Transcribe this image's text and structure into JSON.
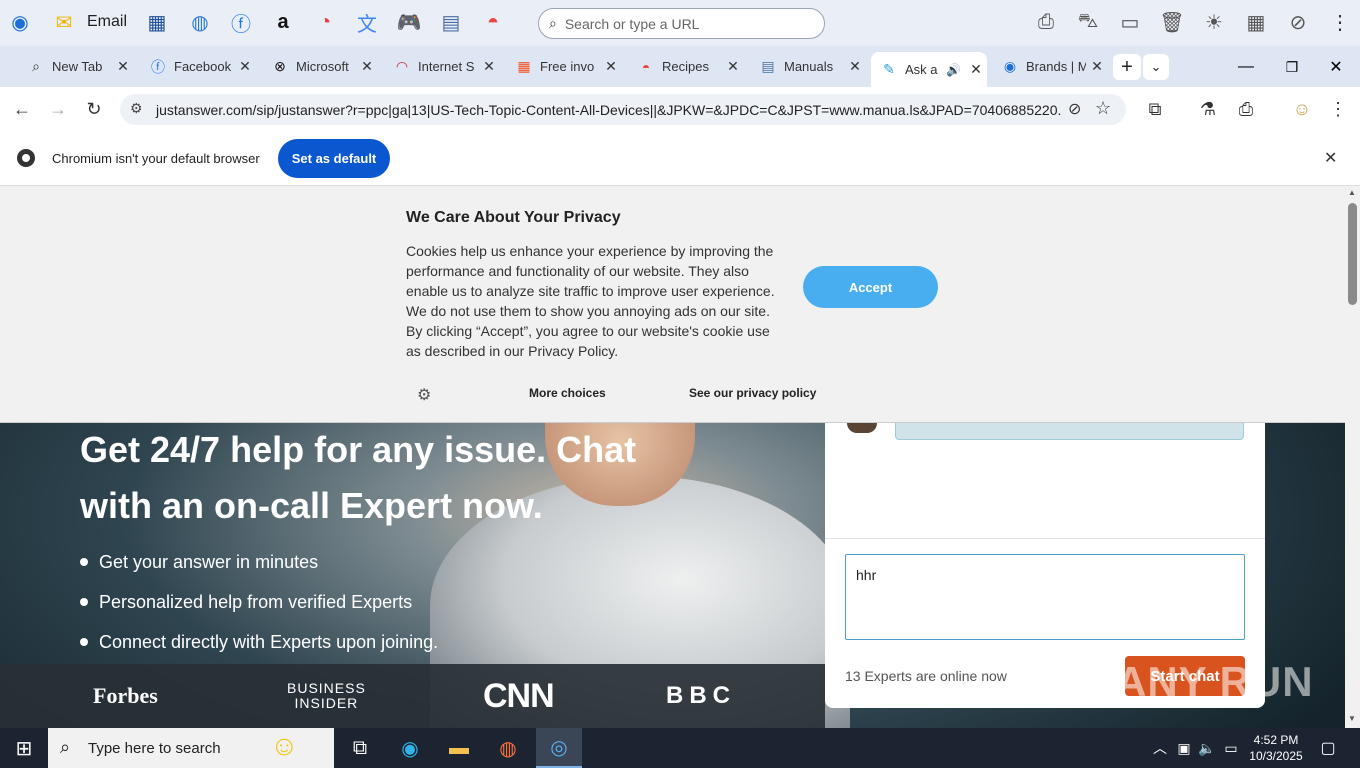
{
  "bookmarks": {
    "email_label": "Email",
    "search_placeholder": "Search or type a URL"
  },
  "tabs": [
    {
      "title": "New Tab",
      "icon": "search-icon"
    },
    {
      "title": "Facebook",
      "icon": "facebook-icon"
    },
    {
      "title": "Microsoft",
      "icon": "xbox-icon"
    },
    {
      "title": "Internet S",
      "icon": "speedometer-icon"
    },
    {
      "title": "Free invo",
      "icon": "windows-icon"
    },
    {
      "title": "Recipes",
      "icon": "watermelon-icon"
    },
    {
      "title": "Manuals",
      "icon": "manual-icon"
    },
    {
      "title": "Ask a",
      "icon": "justanswer-icon"
    },
    {
      "title": "Brands | M",
      "icon": "brands-icon"
    }
  ],
  "address_bar": {
    "url": "justanswer.com/sip/justanswer?r=ppc|ga|13|US-Tech-Topic-Content-All-Devices||&JPKW=&JPDC=C&JPST=www.manua.ls&JPAD=70406885220..."
  },
  "infobar": {
    "message": "Chromium isn't your default browser",
    "button": "Set as default"
  },
  "privacy": {
    "title": "We Care About Your Privacy",
    "body": "Cookies help us enhance your experience by improving the performance and functionality of our website. They also enable us to analyze site traffic to improve user experience. We do not use them to show you annoying ads on our site. By clicking “Accept”, you agree to our website's cookie use as described in our Privacy Policy.",
    "accept": "Accept",
    "more_choices": "More choices",
    "policy": "See our privacy policy"
  },
  "hero": {
    "line1": "Get 24/7 help for any issue. Chat",
    "line2": "with an on-call Expert now.",
    "bullets": [
      "Get your answer in minutes",
      "Personalized help from verified Experts",
      "Connect directly with Experts upon joining."
    ],
    "logos": [
      "Forbes",
      "BUSINESS",
      "INSIDER",
      "CNN",
      "BBC"
    ]
  },
  "chat": {
    "input_value": "hhr",
    "experts_online": "13 Experts are online now",
    "start_button": "Start chat"
  },
  "watermark": "ANY RUN",
  "taskbar": {
    "search_placeholder": "Type here to search",
    "time": "4:52 PM",
    "date": "10/3/2025"
  }
}
